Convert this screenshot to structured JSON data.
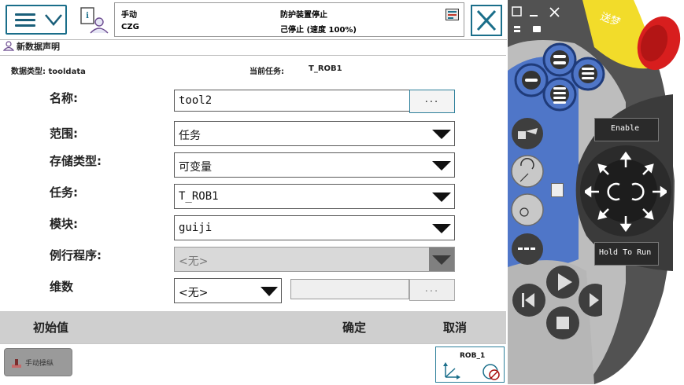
{
  "topbar": {
    "menu_icon": "hamburger-menu-icon",
    "chevron_icon": "chevron-down-icon",
    "info_icon": "info-user-icon",
    "mode": "手动",
    "controller": "CZG",
    "safety_status": "防护装置停止",
    "run_status": "己停止 (速度 100%)",
    "close_icon": "close-icon"
  },
  "dialog": {
    "title": "新数据声明",
    "data_type_label": "数据类型: tooldata",
    "current_task_label": "当前任务: ",
    "current_task_value": "T_ROB1"
  },
  "form": {
    "name": {
      "label": "名称:",
      "value": "tool2",
      "button": "..."
    },
    "scope": {
      "label": "范围:",
      "value": "任务"
    },
    "storage": {
      "label": "存储类型:",
      "value": "可变量"
    },
    "task": {
      "label": "任务:",
      "value": "T_ROB1"
    },
    "module": {
      "label": "模块:",
      "value": "guiji"
    },
    "routine": {
      "label": "例行程序:",
      "value": "<无>"
    },
    "dimension": {
      "label": "维数",
      "value": "<无>",
      "button": "..."
    }
  },
  "actions": {
    "initial_value": "初始值",
    "ok": "确定",
    "cancel": "取消"
  },
  "taskbar": {
    "manual_jog": "手动操纵",
    "rob": "ROB_1"
  },
  "pendant": {
    "enable_label": "Enable",
    "hold_to_run_label": "Hold To Run",
    "brand_text": "送梦"
  },
  "colors": {
    "accent": "#1a6e8a",
    "pendant_body": "#555555",
    "pendant_blue": "#4f76c8",
    "estop_red": "#d81e1e",
    "estop_yellow": "#f2dc2a"
  }
}
